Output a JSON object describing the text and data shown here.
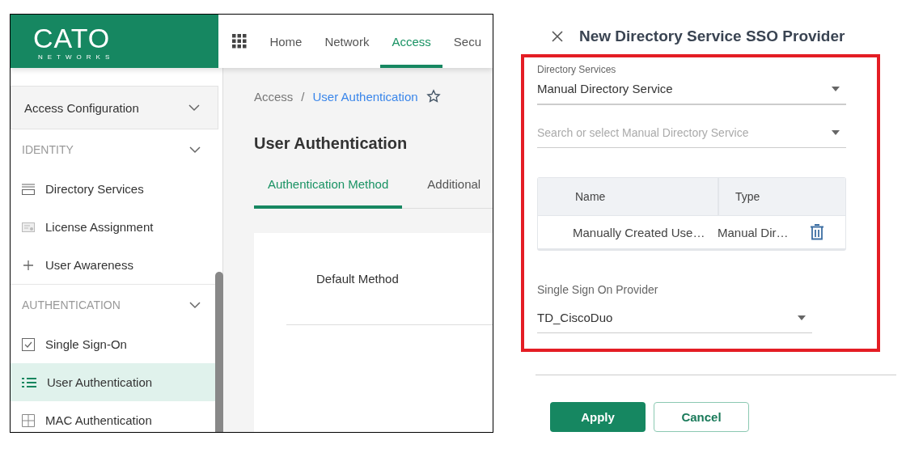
{
  "left_screen": {
    "logo": {
      "name": "CATO",
      "tagline": "NETWORKS"
    },
    "nav": [
      {
        "label": "Home",
        "selected": false
      },
      {
        "label": "Network",
        "selected": false
      },
      {
        "label": "Access",
        "selected": true
      },
      {
        "label": "Secu",
        "selected": false
      }
    ],
    "sidebar": {
      "group": {
        "label": "Access Configuration",
        "expanded": true
      },
      "sections": [
        {
          "label": "IDENTITY",
          "expanded": true,
          "items": [
            {
              "label": "Directory Services",
              "kind": "stack",
              "selected": false
            },
            {
              "label": "License Assignment",
              "kind": "certificate",
              "selected": false
            },
            {
              "label": "User Awareness",
              "kind": "plus",
              "selected": false
            }
          ]
        },
        {
          "label": "AUTHENTICATION",
          "expanded": true,
          "items": [
            {
              "label": "Single Sign-On",
              "kind": "checkbox",
              "selected": false
            },
            {
              "label": "User Authentication",
              "kind": "list",
              "selected": true
            },
            {
              "label": "MAC Authentication",
              "kind": "grid",
              "selected": false
            }
          ]
        }
      ]
    },
    "breadcrumb": [
      {
        "label": "Access",
        "current": false
      },
      {
        "label": "User Authentication",
        "current": true
      }
    ],
    "breadcrumb_separator": "/",
    "page_title": "User Authentication",
    "tabs": [
      {
        "label": "Authentication Method",
        "selected": true
      },
      {
        "label": "Additional",
        "selected": false
      }
    ],
    "card": {
      "label": "Default Method"
    }
  },
  "panel": {
    "title": "New Directory Service SSO Provider",
    "directory_services": {
      "label": "Directory Services",
      "value": "Manual Directory Service"
    },
    "search": {
      "placeholder": "Search or select Manual Directory Service"
    },
    "table": {
      "columns": [
        "Name",
        "Type"
      ],
      "rows": [
        [
          "Manually Created Use…",
          "Manual Dir…"
        ]
      ]
    },
    "sso": {
      "label": "Single Sign On Provider",
      "value": "TD_CiscoDuo"
    },
    "buttons": [
      {
        "label": "Apply",
        "kind": "primary"
      },
      {
        "label": "Cancel",
        "kind": "secondary"
      }
    ]
  }
}
